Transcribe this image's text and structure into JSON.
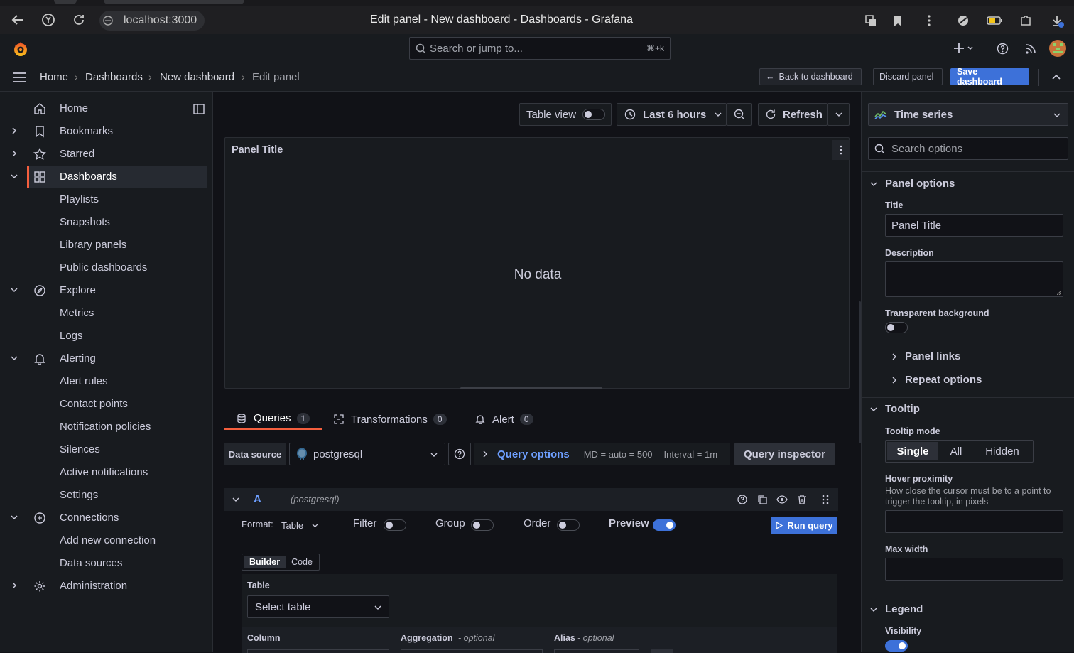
{
  "browser": {
    "address": "localhost:3000",
    "window_title": "Edit panel - New dashboard - Dashboards - Grafana"
  },
  "topbar": {
    "search_placeholder": "Search or jump to...",
    "search_shortcut": "⌘+k"
  },
  "breadcrumb": [
    "Home",
    "Dashboards",
    "New dashboard",
    "Edit panel"
  ],
  "actions": {
    "back": "Back to dashboard",
    "discard": "Discard panel",
    "save": "Save dashboard"
  },
  "sidebar": {
    "items": [
      {
        "label": "Home",
        "icon": "home-icon"
      },
      {
        "label": "Bookmarks",
        "icon": "bookmark-icon"
      },
      {
        "label": "Starred",
        "icon": "star-icon"
      },
      {
        "label": "Dashboards",
        "icon": "dashboards-icon"
      },
      {
        "label": "Playlists"
      },
      {
        "label": "Snapshots"
      },
      {
        "label": "Library panels"
      },
      {
        "label": "Public dashboards"
      },
      {
        "label": "Explore",
        "icon": "compass-icon"
      },
      {
        "label": "Metrics"
      },
      {
        "label": "Logs"
      },
      {
        "label": "Alerting",
        "icon": "bell-icon"
      },
      {
        "label": "Alert rules"
      },
      {
        "label": "Contact points"
      },
      {
        "label": "Notification policies"
      },
      {
        "label": "Silences"
      },
      {
        "label": "Active notifications"
      },
      {
        "label": "Settings"
      },
      {
        "label": "Connections",
        "icon": "connections-icon"
      },
      {
        "label": "Add new connection"
      },
      {
        "label": "Data sources"
      },
      {
        "label": "Administration",
        "icon": "gear-icon"
      }
    ]
  },
  "panel_toolbar": {
    "table_view": "Table view",
    "time_range": "Last 6 hours",
    "refresh": "Refresh"
  },
  "panel": {
    "title": "Panel Title",
    "empty": "No data"
  },
  "query_tabs": [
    {
      "label": "Queries",
      "count": "1"
    },
    {
      "label": "Transformations",
      "count": "0"
    },
    {
      "label": "Alert",
      "count": "0"
    }
  ],
  "query": {
    "data_source_label": "Data source",
    "data_source": "postgresql",
    "query_options": "Query options",
    "md": "MD = auto = 500",
    "interval": "Interval = 1m",
    "inspector": "Query inspector",
    "ref": "A",
    "ref_source": "(postgresql)",
    "format_label": "Format:",
    "format_value": "Table",
    "filter": "Filter",
    "group": "Group",
    "order": "Order",
    "preview": "Preview",
    "run": "Run query",
    "builder": "Builder",
    "code": "Code",
    "table_label": "Table",
    "table_placeholder": "Select table",
    "column_label": "Column",
    "aggregation_label": "Aggregation",
    "alias_label": "Alias",
    "optional": "- optional"
  },
  "options": {
    "viz": "Time series",
    "search_placeholder": "Search options",
    "panel_options": "Panel options",
    "title_label": "Title",
    "title_value": "Panel Title",
    "description_label": "Description",
    "transparent_label": "Transparent background",
    "panel_links": "Panel links",
    "repeat_options": "Repeat options",
    "tooltip": "Tooltip",
    "tooltip_mode": "Tooltip mode",
    "modes": [
      "Single",
      "All",
      "Hidden"
    ],
    "hover_label": "Hover proximity",
    "hover_desc": "How close the cursor must be to a point to trigger the tooltip, in pixels",
    "max_width": "Max width",
    "legend": "Legend",
    "visibility": "Visibility"
  },
  "colors": {
    "accent": "#3d71d9",
    "active_bar": "#f55f3e",
    "link_blue": "#6e9fff"
  }
}
